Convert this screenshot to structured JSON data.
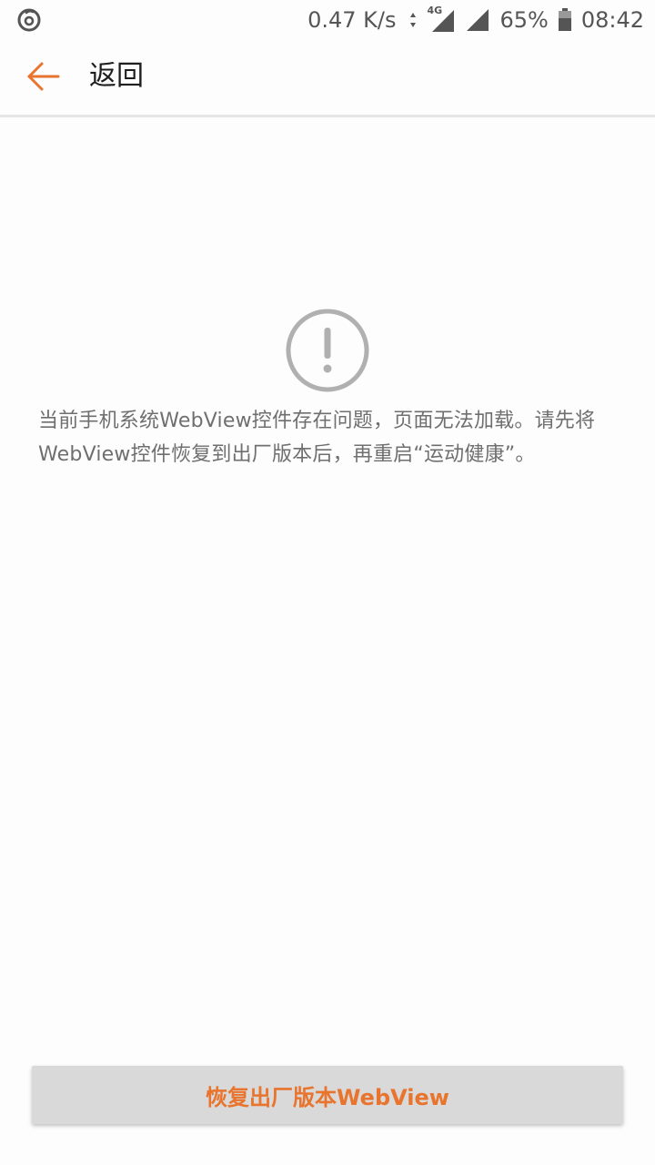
{
  "status_bar": {
    "app_icon": "netease-cloud-music-icon",
    "net_speed": "0.47 K/s",
    "network_type": "4G",
    "battery_percent": "65%",
    "battery_level": 0.65,
    "time": "08:42"
  },
  "header": {
    "back_icon": "arrow-left-icon",
    "title": "返回"
  },
  "content": {
    "error_icon": "exclamation-circle-icon",
    "message": "当前手机系统WebView控件存在问题，页面无法加载。请先将WebView控件恢复到出厂版本后，再重启“运动健康”。"
  },
  "footer": {
    "restore_button_label": "恢复出厂版本WebView"
  },
  "colors": {
    "accent": "#e8742d",
    "background": "#fdfdfd",
    "button_bg": "#d9d9d9",
    "message_text": "#6f6f6f",
    "icon_gray": "#b0b0b0"
  }
}
